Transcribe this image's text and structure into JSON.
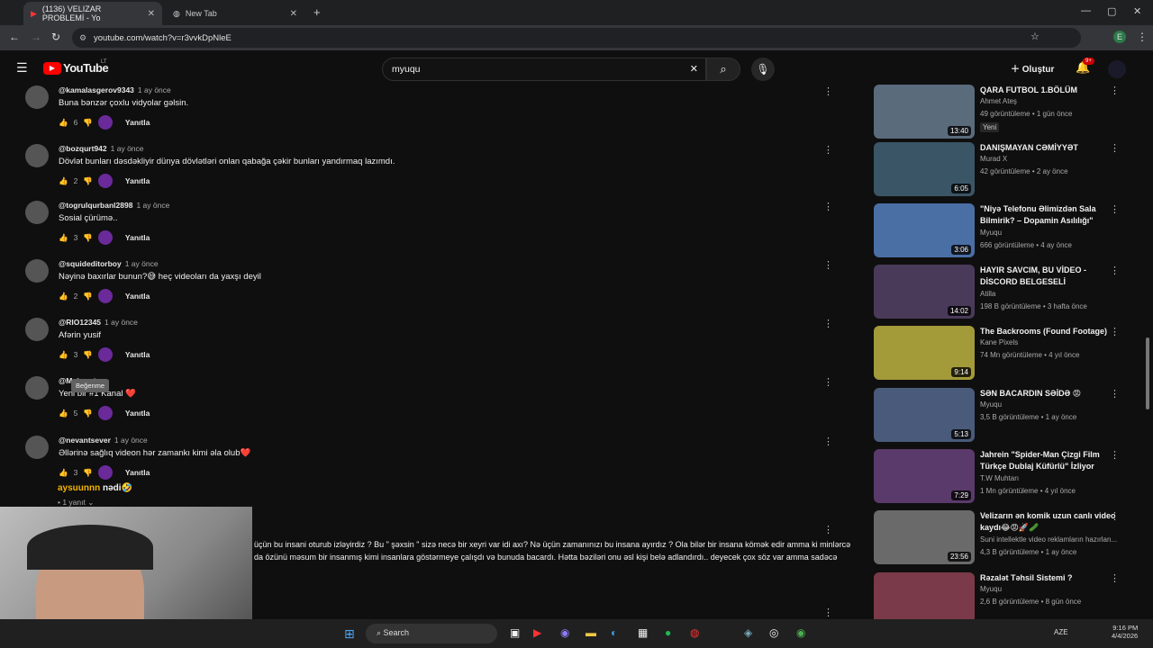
{
  "browser": {
    "tabs": [
      {
        "title": "(1136) VELIZAR PROBLEMİ - Yo"
      },
      {
        "title": "New Tab"
      }
    ],
    "url": "youtube.com/watch?v=r3vvkDpNleE"
  },
  "header": {
    "logo": "YouTube",
    "country": "LT",
    "search_value": "myuqu",
    "create_label": "Oluştur",
    "notif_count": "9+"
  },
  "comments": [
    {
      "user": "@kamalasgerov9343",
      "ago": "1 ay önce",
      "text": "Buna bənzər çoxlu vidyolar gəlsin.",
      "likes": "6",
      "reply": "Yanıtla"
    },
    {
      "user": "@bozqurt942",
      "ago": "1 ay önce",
      "text": "Dövlət bunları dəsdəkliyir dünya dövlətləri onlan qabağa çəkir bunları yandırmaq lazımdı.",
      "likes": "2",
      "reply": "Yanıtla"
    },
    {
      "user": "@togrulqurbanl2898",
      "ago": "1 ay önce",
      "text": "Sosial çürümə..",
      "likes": "3",
      "reply": "Yanıtla"
    },
    {
      "user": "@squideditorboy",
      "ago": "1 ay önce",
      "text": "Nəyinə baxırlar bunun?😅 heç videoları da yaxşı deyil",
      "likes": "2",
      "reply": "Yanıtla"
    },
    {
      "user": "@RIO12345",
      "ago": "1 ay önce",
      "text": "Afərin yusif",
      "likes": "3",
      "reply": "Yanıtla"
    },
    {
      "user": "@M",
      "ago": "1 ay önce",
      "text": "Yeni bir #1 Kanal ❤️",
      "likes": "5",
      "reply": "Yanıtla"
    },
    {
      "user": "@nevantsever",
      "ago": "1 ay önce",
      "text": "Əllərinə sağlıq videon hər zamankı kimi əla olub❤️",
      "likes": "3",
      "reply": "Yanıtla"
    }
  ],
  "tooltip": "Beğenme",
  "reply_preview": {
    "name": "aysuunnn",
    "text": "nədi🤣",
    "count": "• 1 yanıt"
  },
  "long_comment": {
    "line1": "üçün bu insani oturub izləyirdiz ? Bu \" şəxsin \" sizə necə bir xeyri var idi axı? Nə üçün zamanınızı bu insana ayırdız ? Ola bilər bir insana kömək edir amma ki minlərcə",
    "line2": "da özünü məsum bir insanmış kimi insanlara göstərmeye çalışdı və bunuda bacardı. Hətta bəziləri onu əsl kişi belə adlandırdı.. deyecek çox söz var amma sadəcə"
  },
  "sidebar": [
    {
      "title": "QARA FUTBOL 1.BÖLÜM",
      "channel": "Ahmet Ateş",
      "meta": "49 görüntüleme • 1 gün önce",
      "badge": "Yeni",
      "duration": "13:40",
      "color": "#5a6b7c"
    },
    {
      "title": "DANIŞMAYAN CƏMİYYƏT",
      "channel": "Murad X",
      "meta": "42 görüntüleme • 2 ay önce",
      "badge": "",
      "duration": "6:05",
      "color": "#3a5566"
    },
    {
      "title": "\"Niyə Telefonu Əlimizdən Sala Bilmirik? – Dopamin Asılılığı\"",
      "channel": "Myuqu",
      "meta": "666 görüntüleme • 4 ay önce",
      "badge": "",
      "duration": "3:06",
      "color": "#4a6fa5"
    },
    {
      "title": "HAYIR SAVCIM, BU VİDEO - DİSCORD BELGESELİ",
      "channel": "Atilla",
      "meta": "198 B görüntüleme • 3 hafta önce",
      "badge": "",
      "duration": "14:02",
      "color": "#4a3a5a"
    },
    {
      "title": "The Backrooms (Found Footage)",
      "channel": "Kane Pixels",
      "meta": "74 Mn görüntüleme • 4 yıl önce",
      "badge": "",
      "duration": "9:14",
      "color": "#a39a3a"
    },
    {
      "title": "SƏN BACARDIN SƏİDƏ 😡",
      "channel": "Myuqu",
      "meta": "3,5 B görüntüleme • 1 ay önce",
      "badge": "",
      "duration": "5:13",
      "color": "#4a5a7a"
    },
    {
      "title": "Jahrein \"Spider-Man Çizgi Film Türkçe Dublaj Küfürlü\" İzliyor",
      "channel": "T.W Muhtarı",
      "meta": "1 Mn görüntüleme • 4 yıl önce",
      "badge": "",
      "duration": "7:29",
      "color": "#5a3a6a"
    },
    {
      "title": "Velizarın ən komik uzun canlı video kaydı😂😡🚀🥒",
      "channel": "Suni intellektle video reklamların hazırlan...",
      "meta": "4,3 B görüntüleme • 1 ay önce",
      "badge": "",
      "duration": "23:56",
      "color": "#6a6a6a"
    },
    {
      "title": "Rəzalət Təhsil Sistemi ?",
      "channel": "Myuqu",
      "meta": "2,6 B görüntüleme • 8 gün önce",
      "badge": "",
      "duration": "",
      "color": "#7a3a4a"
    }
  ],
  "taskbar": {
    "search": "Search",
    "lang": "AZE",
    "time": "9:16 PM",
    "date": "4/4/2026"
  }
}
